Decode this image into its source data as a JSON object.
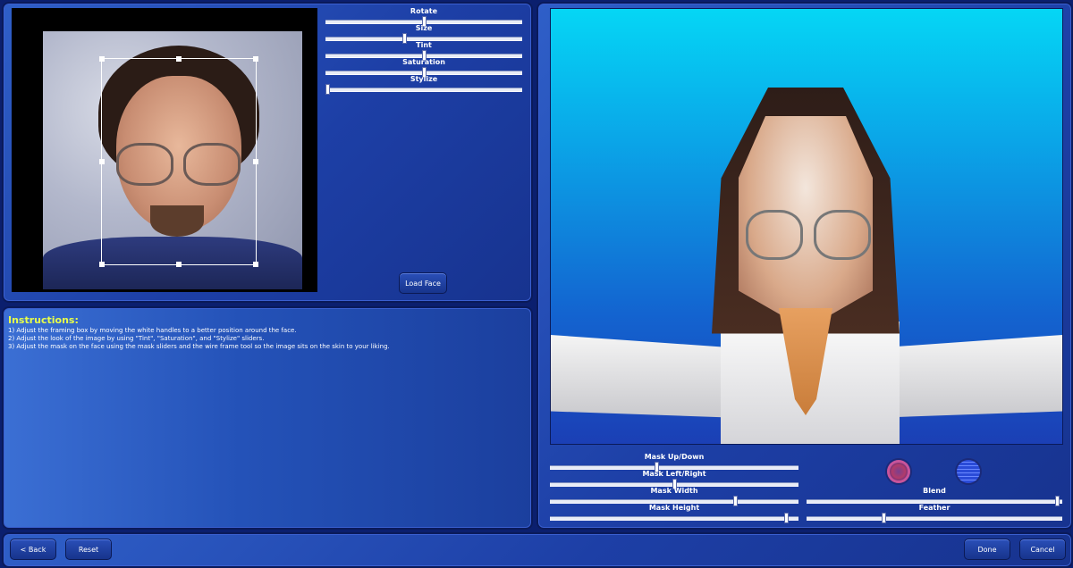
{
  "face_panel": {
    "sliders": [
      {
        "label": "Rotate",
        "value_pct": 50
      },
      {
        "label": "Size",
        "value_pct": 40
      },
      {
        "label": "Tint",
        "value_pct": 50
      },
      {
        "label": "Saturation",
        "value_pct": 50
      },
      {
        "label": "Stylize",
        "value_pct": 0
      }
    ],
    "load_face_label": "Load Face"
  },
  "instructions": {
    "title": "Instructions:",
    "lines": [
      "1) Adjust the framing box by moving the white handles to a better position around the face.",
      "2) Adjust the look of the image by using \"Tint\", \"Saturation\", and \"Stylize\" sliders.",
      "3) Adjust the mask on the face using the mask sliders and the wire frame tool so the image sits on the skin to your liking."
    ]
  },
  "preview_panel": {
    "sliders": [
      {
        "label": "Mask Up/Down",
        "value_pct": 43
      },
      {
        "label": "Mask Left/Right",
        "value_pct": 50
      },
      {
        "label": "Mask Width",
        "value_pct": 75
      },
      {
        "label": "Mask Height",
        "value_pct": 96
      },
      {
        "label": "Blend",
        "value_pct": 99
      },
      {
        "label": "Feather",
        "value_pct": 30
      }
    ],
    "tool_icons": [
      "color-swatch-icon",
      "wireframe-icon"
    ]
  },
  "bottom_bar": {
    "back_label": "< Back",
    "reset_label": "Reset",
    "done_label": "Done",
    "cancel_label": "Cancel"
  }
}
